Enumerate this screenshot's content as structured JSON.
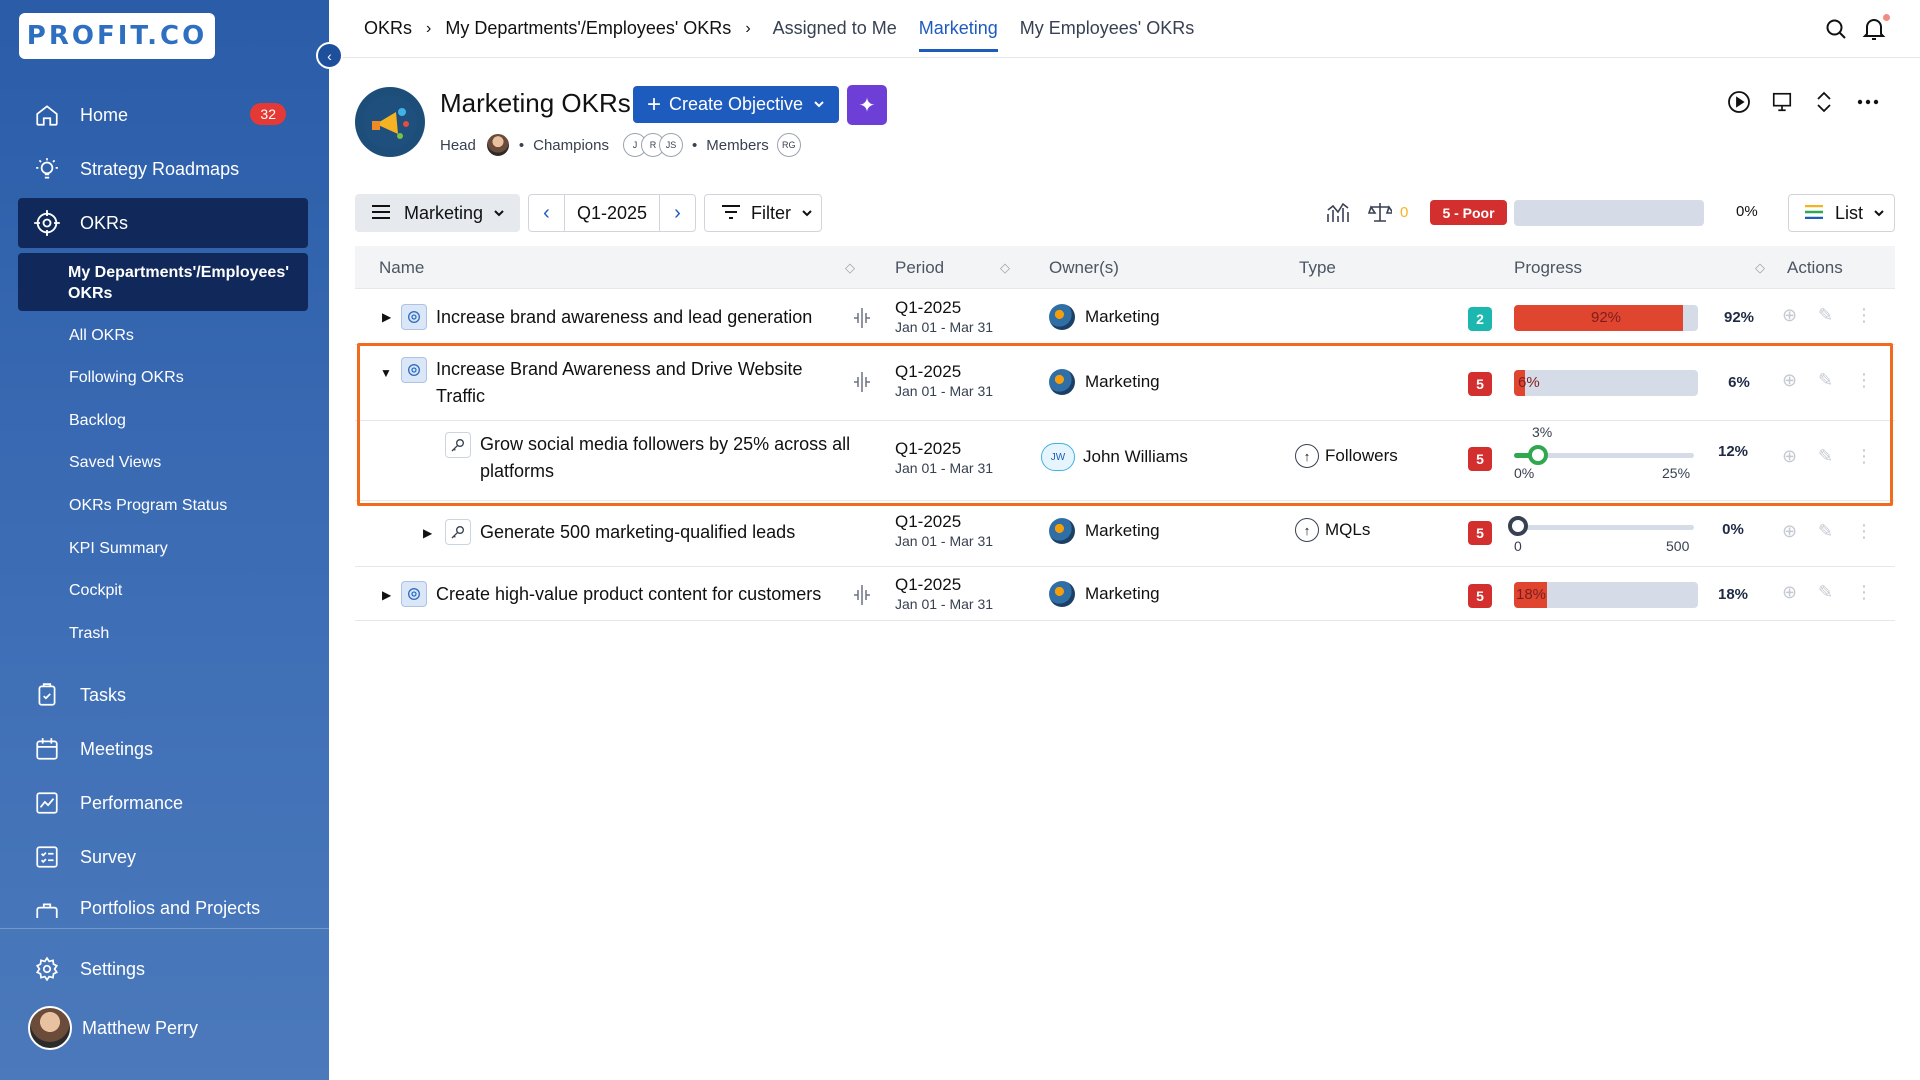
{
  "app": {
    "logo": "PROFIT.CO"
  },
  "sidebar": {
    "home_label": "Home",
    "home_badge": "32",
    "strategy_label": "Strategy Roadmaps",
    "okrs_label": "OKRs",
    "sub_active": "My Departments'/Employees' OKRs",
    "sub_items": [
      "All OKRs",
      "Following OKRs",
      "Backlog",
      "Saved Views",
      "OKRs Program Status",
      "KPI Summary",
      "Cockpit",
      "Trash"
    ],
    "tasks_label": "Tasks",
    "meetings_label": "Meetings",
    "performance_label": "Performance",
    "survey_label": "Survey",
    "portfolios_label": "Portfolios and Projects",
    "settings_label": "Settings",
    "user_name": "Matthew Perry"
  },
  "topbar": {
    "crumb1": "OKRs",
    "crumb2": "My Departments'/Employees' OKRs",
    "sep": "›",
    "tabs": [
      "Assigned to Me",
      "Marketing",
      "My Employees' OKRs"
    ],
    "active_tab": "Marketing"
  },
  "header": {
    "title": "Marketing OKRs",
    "create_label": "Create Objective",
    "head_label": "Head",
    "champions_label": "Champions",
    "champions": [
      "J",
      "R",
      "JS"
    ],
    "members_label": "Members",
    "members": [
      "RG"
    ]
  },
  "toolbar": {
    "dept": "Marketing",
    "period": "Q1-2025",
    "filter_label": "Filter",
    "score_count": "0",
    "status_badge": "5 - Poor",
    "overall_pct": "0%",
    "overall_progress": 0,
    "view_label": "List"
  },
  "table": {
    "headers": {
      "name": "Name",
      "period": "Period",
      "owners": "Owner(s)",
      "type": "Type",
      "progress": "Progress",
      "actions": "Actions"
    },
    "rows": [
      {
        "name": "Increase brand awareness and lead generation",
        "period": "Q1-2025",
        "dates": "Jan 01 - Mar 31",
        "owner": "Marketing",
        "type": "",
        "score": "2",
        "progress_label": "92%",
        "progress": 92,
        "pct": "92%"
      },
      {
        "name": "Increase Brand Awareness and Drive Website Traffic",
        "period": "Q1-2025",
        "dates": "Jan 01 - Mar 31",
        "owner": "Marketing",
        "type": "",
        "score": "5",
        "progress_label": "6%",
        "progress": 6,
        "pct": "6%"
      },
      {
        "name": "Grow social media followers by 25% across all platforms",
        "period": "Q1-2025",
        "dates": "Jan 01 - Mar 31",
        "owner": "John Williams",
        "type": "Followers",
        "score": "5",
        "current": "3%",
        "start": "0%",
        "target": "25%",
        "progress": 12,
        "pct": "12%"
      },
      {
        "name": "Generate 500 marketing-qualified leads",
        "period": "Q1-2025",
        "dates": "Jan 01 - Mar 31",
        "owner": "Marketing",
        "type": "MQLs",
        "score": "5",
        "start": "0",
        "target": "500",
        "progress": 0,
        "pct": "0%"
      },
      {
        "name": "Create high-value product content for customers",
        "period": "Q1-2025",
        "dates": "Jan 01 - Mar 31",
        "owner": "Marketing",
        "type": "",
        "score": "5",
        "progress_label": "18%",
        "progress": 18,
        "pct": "18%"
      }
    ]
  },
  "colors": {
    "primary": "#1e5bbf",
    "poor": "#d32f2f",
    "good": "#1cb8b0",
    "highlight": "#f26a1b",
    "bar_fill": "#e0462f",
    "slider": "#2fa84f"
  }
}
